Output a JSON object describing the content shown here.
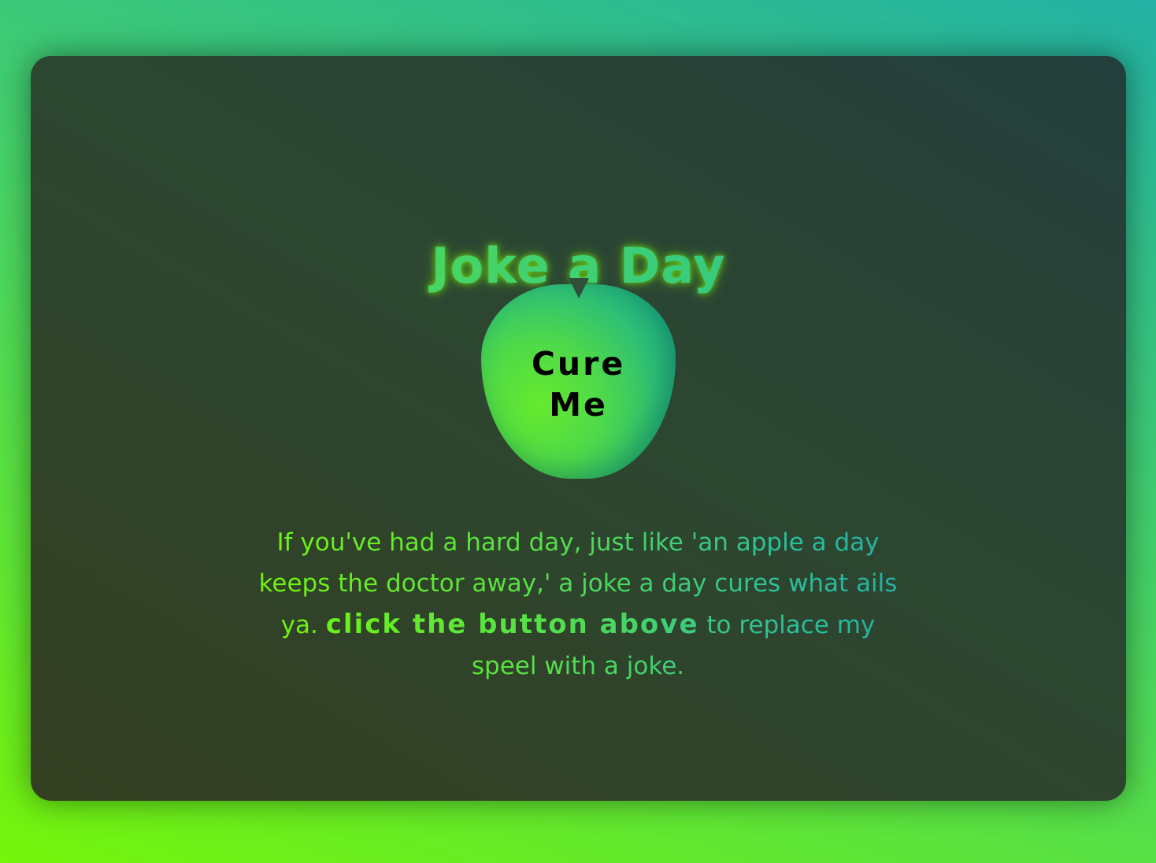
{
  "header": {
    "title": "Joke a Day"
  },
  "button": {
    "label": "Cure Me"
  },
  "description": {
    "text_before": "If you've had a hard day, just like 'an apple a day keeps the doctor away,' a joke a day cures what ails ya.",
    "cta": "click the button above",
    "text_after": "to replace my speel with a joke."
  },
  "colors": {
    "background_start": "#74f50a",
    "background_end": "#22b1a4",
    "card": "#2c4631",
    "apple": "#4ed94a"
  },
  "icons": {
    "apple": "apple-icon",
    "stem": "apple-stem-icon"
  }
}
